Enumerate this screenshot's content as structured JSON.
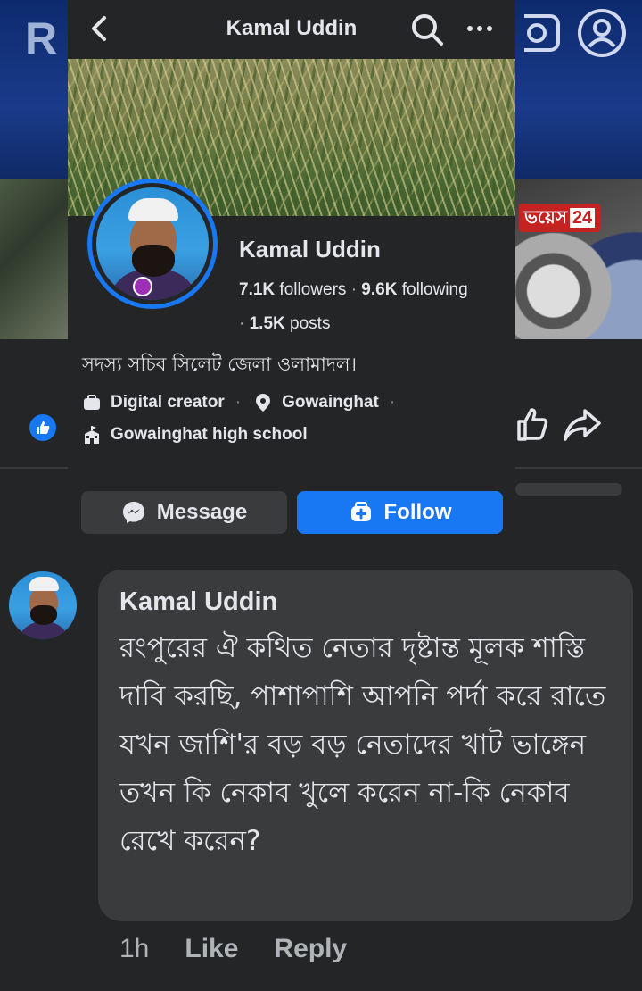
{
  "background": {
    "banner_letters": "R",
    "logo_text": "ভয়েস",
    "logo_number": "24"
  },
  "header": {
    "title": "Kamal Uddin"
  },
  "profile": {
    "name": "Kamal Uddin",
    "followers_count": "7.1K",
    "followers_label": "followers",
    "following_count": "9.6K",
    "following_label": "following",
    "posts_count": "1.5K",
    "posts_label": "posts",
    "bio": "সদস্য সচিব সিলেট জেলা ওলামাদল।",
    "category": "Digital creator",
    "location": "Gowainghat",
    "education": "Gowainghat high school"
  },
  "buttons": {
    "message": "Message",
    "follow": "Follow"
  },
  "comment": {
    "author": "Kamal Uddin",
    "text": "রংপুরের ঐ কথিত নেতার দৃষ্টান্ত মূলক শাস্তি দাবি করছি, পাশাপাশি আপনি পর্দা করে রাতে যখন জাশি'র বড় বড় নেতাদের খাট ভাঙ্গেন তখন কি নেকাব খুলে করেন না-কি নেকাব রেখে করেন?",
    "time": "1h",
    "like_label": "Like",
    "reply_label": "Reply"
  },
  "colors": {
    "accent": "#1877f2",
    "surface": "#242526",
    "bubble": "#3a3b3c"
  },
  "icons": [
    "back-arrow-icon",
    "search-icon",
    "more-icon",
    "briefcase-icon",
    "location-pin-icon",
    "school-icon",
    "messenger-icon",
    "add-friend-icon",
    "like-icon",
    "share-icon",
    "camera-icon",
    "profile-icon"
  ]
}
